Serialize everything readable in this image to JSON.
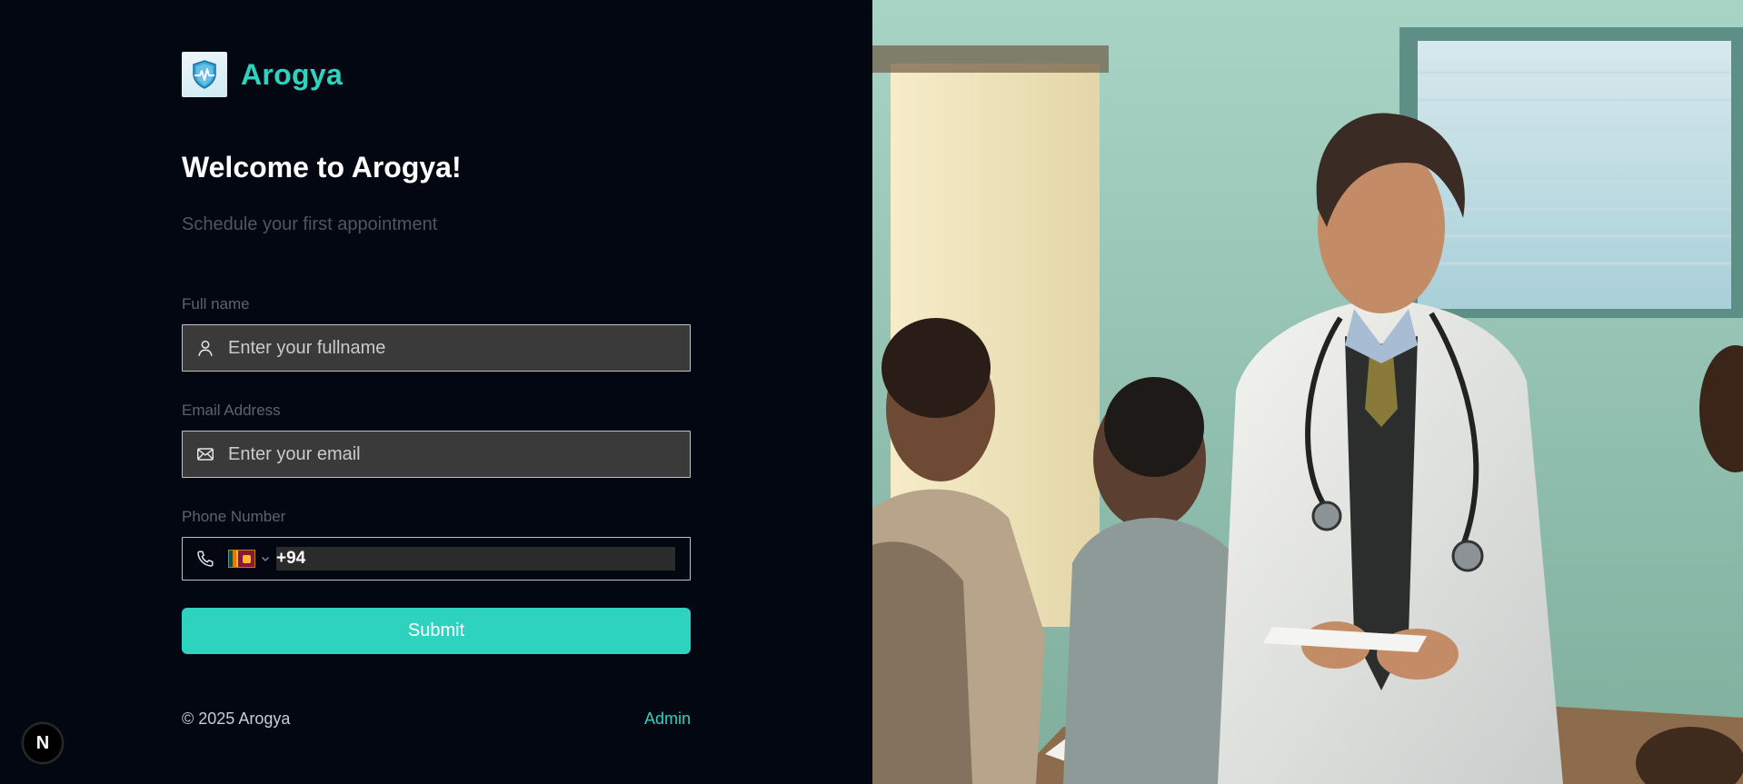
{
  "brand": {
    "name": "Arogya",
    "logo_icon": "shield-heartbeat-icon"
  },
  "hero": {
    "title": "Welcome to Arogya!",
    "subtitle": "Schedule your first appointment"
  },
  "form": {
    "full_name": {
      "label": "Full name",
      "placeholder": "Enter your fullname",
      "value": "",
      "icon": "user-icon"
    },
    "email": {
      "label": "Email Address",
      "placeholder": "Enter your email",
      "value": "",
      "icon": "mail-icon"
    },
    "phone": {
      "label": "Phone Number",
      "country_code": "+94",
      "country_flag": "sri-lanka-flag-icon",
      "icon": "phone-icon"
    },
    "submit_label": "Submit"
  },
  "footer": {
    "copyright": "© 2025 Arogya",
    "admin_link": "Admin"
  },
  "dev_badge": {
    "label": "N"
  },
  "colors": {
    "background": "#020712",
    "accent": "#2ed3c0",
    "input_bg": "#3a3a3a",
    "label": "#5d636d"
  },
  "illustration": {
    "subject": "doctor-with-patients-photo"
  }
}
